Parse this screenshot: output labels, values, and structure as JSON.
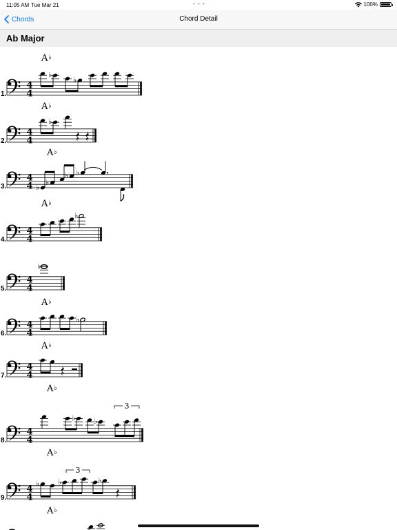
{
  "status_bar": {
    "time": "11:05 AM",
    "date": "Tue Mar 21",
    "dots": "• • •",
    "battery": "100%",
    "battery_level": 1.0,
    "icons": [
      "wifi-icon",
      "battery-icon"
    ]
  },
  "nav": {
    "back_label": "Chords",
    "title": "Chord Detail",
    "back_icon": "chevron-left-icon"
  },
  "section": {
    "title": "Ab Major"
  },
  "accent_color": "#0a7aff",
  "exercises": [
    {
      "number": "1.",
      "chord": "Ab"
    },
    {
      "number": "2.",
      "chord": "Ab"
    },
    {
      "number": "3.",
      "chord": "Ab"
    },
    {
      "number": "4.",
      "chord": "Ab"
    },
    {
      "number": "5.",
      "chord": ""
    },
    {
      "number": "6.",
      "chord": "Ab"
    },
    {
      "number": "7.",
      "chord": "Ab"
    },
    {
      "number": "8.",
      "chord": "Ab"
    },
    {
      "number": "9.",
      "chord": "Ab"
    },
    {
      "number": "",
      "chord": "Ab"
    }
  ],
  "tuplet_label": "3"
}
